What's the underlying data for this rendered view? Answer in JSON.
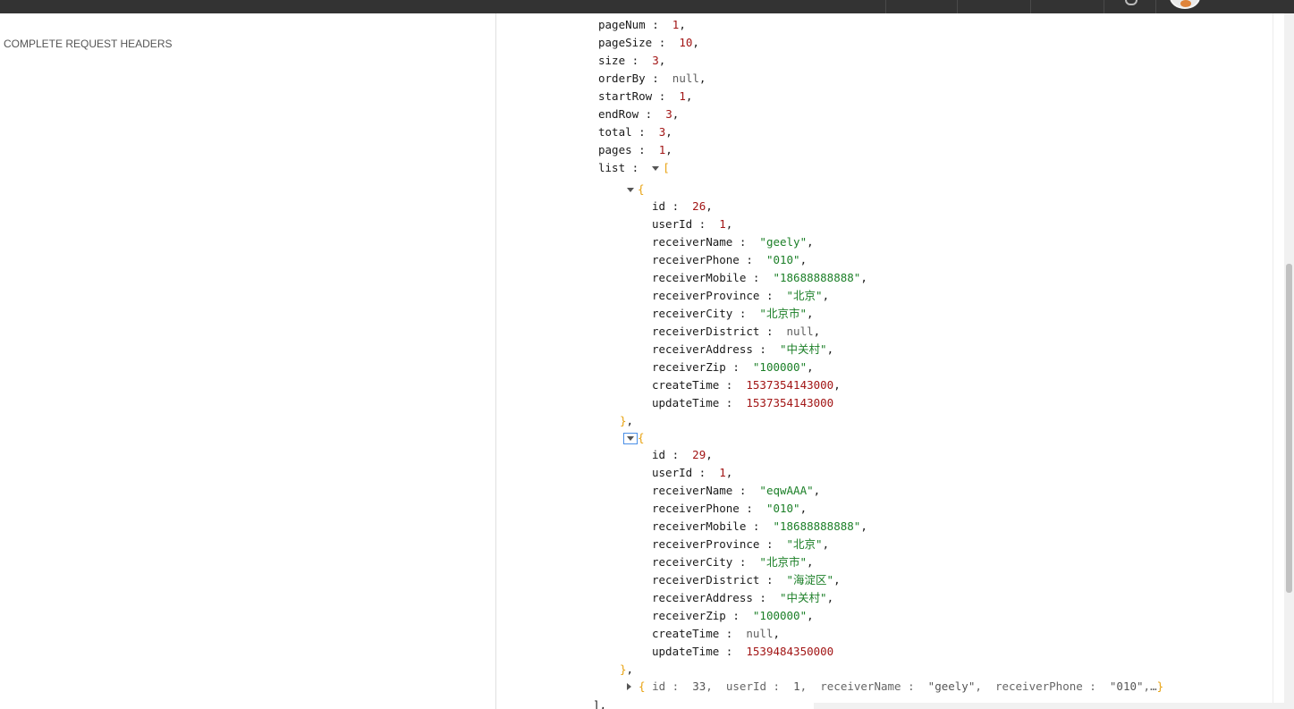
{
  "left_pane": {
    "section_label": "COMPLETE REQUEST HEADERS"
  },
  "json_view": {
    "top_fields": [
      {
        "key": "pageNum",
        "value": "1",
        "type": "num",
        "comma": true
      },
      {
        "key": "pageSize",
        "value": "10",
        "type": "num",
        "comma": true
      },
      {
        "key": "size",
        "value": "3",
        "type": "num",
        "comma": true
      },
      {
        "key": "orderBy",
        "value": "null",
        "type": "nul",
        "comma": true
      },
      {
        "key": "startRow",
        "value": "1",
        "type": "num",
        "comma": true
      },
      {
        "key": "endRow",
        "value": "3",
        "type": "num",
        "comma": true
      },
      {
        "key": "total",
        "value": "3",
        "type": "num",
        "comma": true
      },
      {
        "key": "pages",
        "value": "1",
        "type": "num",
        "comma": true
      }
    ],
    "list_key": "list",
    "items": [
      {
        "fields": [
          {
            "key": "id",
            "value": "26",
            "type": "num",
            "comma": true
          },
          {
            "key": "userId",
            "value": "1",
            "type": "num",
            "comma": true
          },
          {
            "key": "receiverName",
            "value": "\"geely\"",
            "type": "str",
            "comma": true
          },
          {
            "key": "receiverPhone",
            "value": "\"010\"",
            "type": "str",
            "comma": true
          },
          {
            "key": "receiverMobile",
            "value": "\"18688888888\"",
            "type": "str",
            "comma": true
          },
          {
            "key": "receiverProvince",
            "value": "\"北京\"",
            "type": "str",
            "comma": true
          },
          {
            "key": "receiverCity",
            "value": "\"北京市\"",
            "type": "str",
            "comma": true
          },
          {
            "key": "receiverDistrict",
            "value": "null",
            "type": "nul",
            "comma": true
          },
          {
            "key": "receiverAddress",
            "value": "\"中关村\"",
            "type": "str",
            "comma": true
          },
          {
            "key": "receiverZip",
            "value": "\"100000\"",
            "type": "str",
            "comma": true
          },
          {
            "key": "createTime",
            "value": "1537354143000",
            "type": "num",
            "comma": true
          },
          {
            "key": "updateTime",
            "value": "1537354143000",
            "type": "num",
            "comma": false
          }
        ]
      },
      {
        "fields": [
          {
            "key": "id",
            "value": "29",
            "type": "num",
            "comma": true
          },
          {
            "key": "userId",
            "value": "1",
            "type": "num",
            "comma": true
          },
          {
            "key": "receiverName",
            "value": "\"eqwAAA\"",
            "type": "str",
            "comma": true
          },
          {
            "key": "receiverPhone",
            "value": "\"010\"",
            "type": "str",
            "comma": true
          },
          {
            "key": "receiverMobile",
            "value": "\"18688888888\"",
            "type": "str",
            "comma": true
          },
          {
            "key": "receiverProvince",
            "value": "\"北京\"",
            "type": "str",
            "comma": true
          },
          {
            "key": "receiverCity",
            "value": "\"北京市\"",
            "type": "str",
            "comma": true
          },
          {
            "key": "receiverDistrict",
            "value": "\"海淀区\"",
            "type": "str",
            "comma": true
          },
          {
            "key": "receiverAddress",
            "value": "\"中关村\"",
            "type": "str",
            "comma": true
          },
          {
            "key": "receiverZip",
            "value": "\"100000\"",
            "type": "str",
            "comma": true
          },
          {
            "key": "createTime",
            "value": "null",
            "type": "nul",
            "comma": true
          },
          {
            "key": "updateTime",
            "value": "1539484350000",
            "type": "num",
            "comma": false
          }
        ]
      }
    ],
    "collapsed_item": {
      "preview": [
        {
          "key": "id",
          "value": "33"
        },
        {
          "key": "userId",
          "value": "1"
        },
        {
          "key": "receiverName",
          "value": "\"geely\""
        },
        {
          "key": "receiverPhone",
          "value": "\"010\""
        }
      ],
      "ellipsis": "…"
    }
  }
}
